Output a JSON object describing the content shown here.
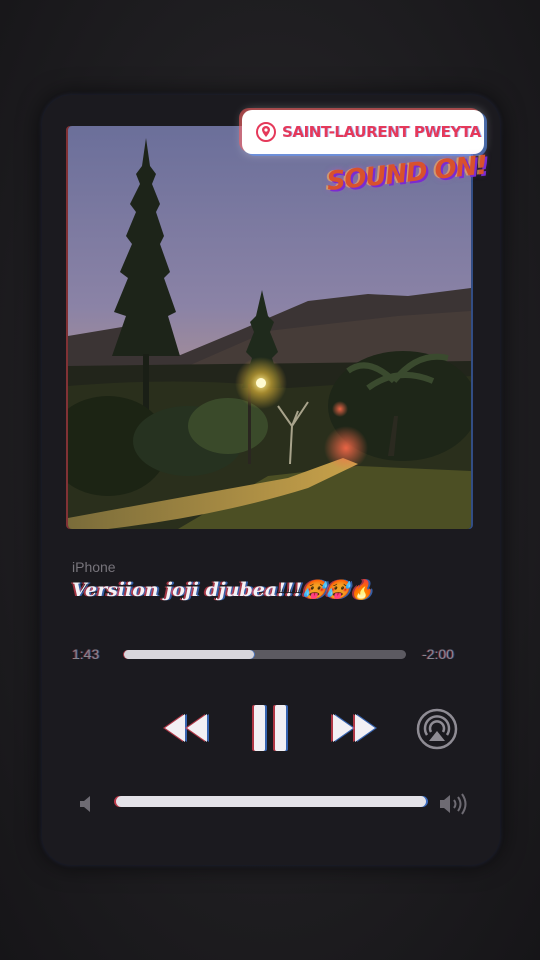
{
  "location_sticker": {
    "text": "SAINT-LAURENT PWEYTA",
    "icon": "location-pin-icon",
    "color": "#e5395a"
  },
  "sound_sticker": {
    "text": "SOUND ON!",
    "color": "#d8512e"
  },
  "now_playing": {
    "device": "iPhone",
    "title": "Versiion joji djubea!!!🥵🥵🔥"
  },
  "playback": {
    "elapsed": "1:43",
    "remaining": "-2:00",
    "progress_fraction": 0.46
  },
  "controls": {
    "rewind_icon": "rewind-icon",
    "pause_icon": "pause-icon",
    "forward_icon": "fast-forward-icon",
    "airplay_icon": "airplay-icon"
  },
  "volume": {
    "level_fraction": 1.0,
    "low_icon": "volume-low-icon",
    "high_icon": "volume-high-icon"
  }
}
